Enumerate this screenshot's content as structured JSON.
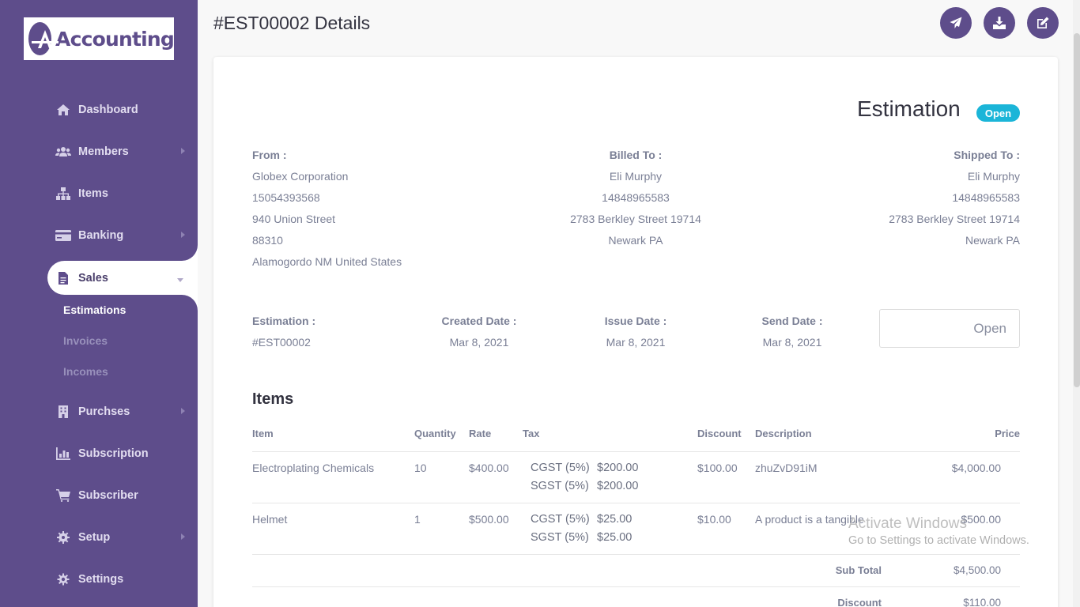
{
  "app": {
    "logo_text": "Accounting"
  },
  "sidebar": {
    "items": [
      {
        "label": "Dashboard",
        "icon": "home-icon"
      },
      {
        "label": "Members",
        "icon": "users-icon"
      },
      {
        "label": "Items",
        "icon": "sitemap-icon"
      },
      {
        "label": "Banking",
        "icon": "credit-card-icon"
      },
      {
        "label": "Sales",
        "icon": "file-icon"
      },
      {
        "label": "Purchses",
        "icon": "building-icon"
      },
      {
        "label": "Subscription",
        "icon": "chart-icon"
      },
      {
        "label": "Subscriber",
        "icon": "cart-icon"
      },
      {
        "label": "Setup",
        "icon": "cog-icon"
      },
      {
        "label": "Settings",
        "icon": "gear-icon"
      }
    ],
    "sales_sub": [
      "Estimations",
      "Invoices",
      "Incomes"
    ]
  },
  "header": {
    "title": "#EST00002 Details",
    "buttons": [
      "send-icon",
      "download-icon",
      "edit-icon"
    ]
  },
  "estimation": {
    "heading": "Estimation",
    "status_badge": "Open",
    "from": {
      "label": "From :",
      "lines": [
        "Globex Corporation",
        "15054393568",
        "940 Union Street",
        "88310",
        "Alamogordo NM United States"
      ]
    },
    "billed_to": {
      "label": "Billed To :",
      "lines": [
        "Eli Murphy",
        "14848965583",
        "2783 Berkley Street 19714",
        "Newark PA"
      ]
    },
    "shipped_to": {
      "label": "Shipped To :",
      "lines": [
        "Eli Murphy",
        "14848965583",
        "2783 Berkley Street 19714",
        "Newark PA"
      ]
    },
    "meta": {
      "estimation_label": "Estimation :",
      "estimation_value": "#EST00002",
      "created_label": "Created Date :",
      "created_value": "Mar 8, 2021",
      "issue_label": "Issue Date :",
      "issue_value": "Mar 8, 2021",
      "send_label": "Send Date :",
      "send_value": "Mar 8, 2021",
      "status_select": "Open"
    },
    "items_title": "Items",
    "columns": [
      "Item",
      "Quantity",
      "Rate",
      "Tax",
      "Discount",
      "Description",
      "Price"
    ],
    "rows": [
      {
        "item": "Electroplating Chemicals",
        "quantity": "10",
        "rate": "$400.00",
        "taxes": [
          [
            "CGST (5%)",
            "$200.00"
          ],
          [
            "SGST (5%)",
            "$200.00"
          ]
        ],
        "discount": "$100.00",
        "description": "zhuZvD91iM",
        "price": "$4,000.00"
      },
      {
        "item": "Helmet",
        "quantity": "1",
        "rate": "$500.00",
        "taxes": [
          [
            "CGST (5%)",
            "$25.00"
          ],
          [
            "SGST (5%)",
            "$25.00"
          ]
        ],
        "discount": "$10.00",
        "description": "A product is a tangible",
        "price": "$500.00"
      }
    ],
    "totals": [
      {
        "label": "Sub Total",
        "value": "$4,500.00"
      },
      {
        "label": "Discount",
        "value": "$110.00"
      }
    ]
  },
  "watermark": {
    "line1": "Activate Windows",
    "line2": "Go to Settings to activate Windows."
  }
}
